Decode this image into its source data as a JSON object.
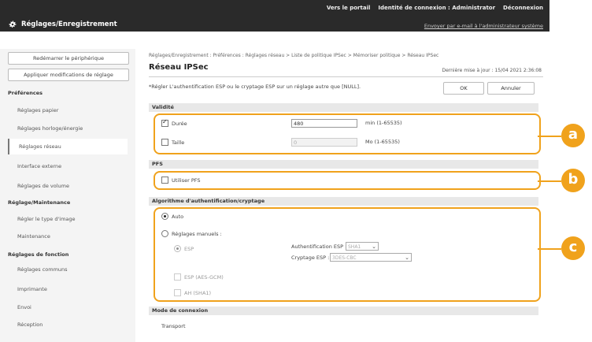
{
  "header": {
    "links": [
      "Vers le portail",
      "Identité de connexion : Administrator",
      "Déconnexion"
    ],
    "title": "Réglages/Enregistrement",
    "mail_link": "Envoyer par e-mail à l'administrateur système"
  },
  "sidebar": {
    "restart_button": "Redémarrer le périphérique",
    "apply_button": "Appliquer modifications de réglage",
    "sections": [
      {
        "title": "Préférences",
        "items": [
          "Réglages papier",
          "Réglages horloge/énergie",
          "Réglages réseau",
          "Interface externe",
          "Réglages de volume"
        ]
      },
      {
        "title": "Réglage/Maintenance",
        "items": [
          "Régler le type d'image",
          "Maintenance"
        ]
      },
      {
        "title": "Réglages de fonction",
        "items": [
          "Réglages communs",
          "Imprimante",
          "Envoi",
          "Réception"
        ]
      }
    ],
    "active_item": "Réglages réseau"
  },
  "main": {
    "breadcrumb": "Réglages/Enregistrement : Préférences : Réglages réseau > Liste de politique IPSec > Mémoriser politique > Réseau IPSec",
    "title": "Réseau IPSec",
    "updated": "Dernière mise à jour : 15/04 2021 2:36:08",
    "note": "*Régler L'authentification ESP ou le cryptage ESP sur un réglage autre que [NULL].",
    "ok_button": "OK",
    "cancel_button": "Annuler",
    "validity": {
      "header": "Validité",
      "duration_label": "Durée",
      "duration_value": "480",
      "duration_unit": "min (1-65535)",
      "size_label": "Taille",
      "size_value": "0",
      "size_unit": "Mo (1-65535)"
    },
    "pfs": {
      "header": "PFS",
      "use_label": "Utiliser PFS"
    },
    "algo": {
      "header": "Algorithme d'authentification/cryptage",
      "auto_label": "Auto",
      "manual_label": "Réglages manuels :",
      "esp_label": "ESP",
      "esp_auth_label": "Authentification ESP :",
      "esp_auth_value": "SHA1",
      "esp_crypt_label": "Cryptage ESP :",
      "esp_crypt_value": "3DES-CBC",
      "esp_aes_label": "ESP (AES-GCM)",
      "ah_label": "AH (SHA1)"
    },
    "connection": {
      "header": "Mode de connexion",
      "value": "Transport"
    }
  },
  "callouts": [
    "a",
    "b",
    "c"
  ],
  "colors": {
    "accent": "#f0a21c",
    "header_bg": "#2a2a2a"
  }
}
